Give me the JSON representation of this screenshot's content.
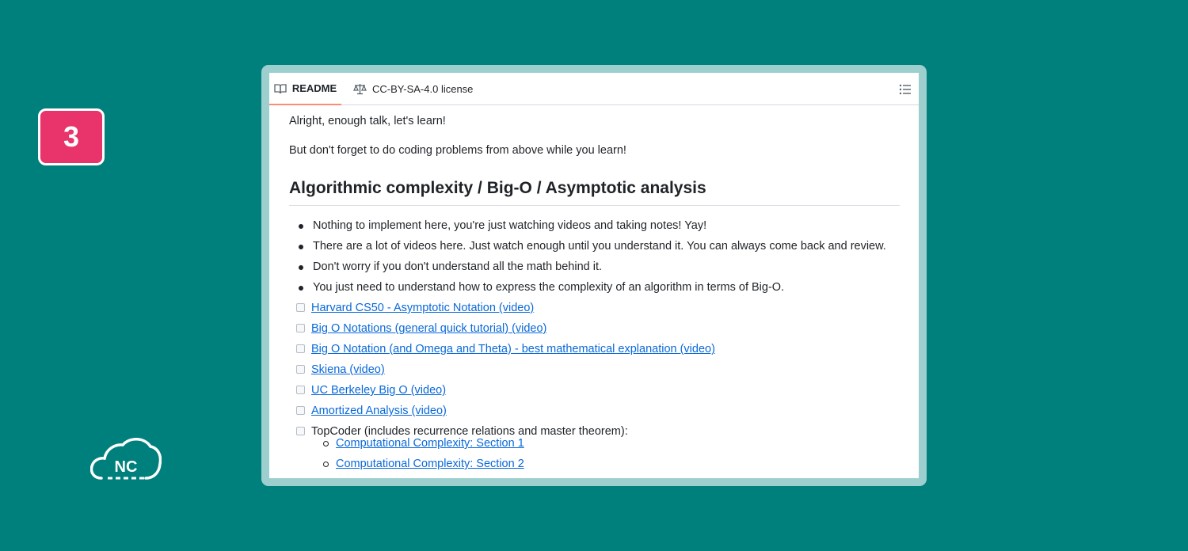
{
  "step_badge": "3",
  "tabs": {
    "readme": "README",
    "license": "CC-BY-SA-4.0 license"
  },
  "readme": {
    "intro": "Alright, enough talk, let's learn!",
    "reminder": "But don't forget to do coding problems from above while you learn!",
    "heading": "Algorithmic complexity / Big-O / Asymptotic analysis",
    "bullets": [
      "Nothing to implement here, you're just watching videos and taking notes! Yay!",
      "There are a lot of videos here. Just watch enough until you understand it. You can always come back and review.",
      "Don't worry if you don't understand all the math behind it.",
      "You just need to understand how to express the complexity of an algorithm in terms of Big-O."
    ],
    "tasks": [
      "Harvard CS50 - Asymptotic Notation (video)",
      "Big O Notations (general quick tutorial) (video)",
      "Big O Notation (and Omega and Theta) - best mathematical explanation (video)",
      "Skiena (video)",
      "UC Berkeley Big O (video)",
      "Amortized Analysis (video)",
      "TopCoder (includes recurrence relations and master theorem):"
    ],
    "subitems": [
      "Computational Complexity: Section 1",
      "Computational Complexity: Section 2"
    ]
  },
  "logo_text": "NC",
  "colors": {
    "background": "#00807c",
    "badge": "#e8336b",
    "frame": "#9ecfcf",
    "link": "#0969da",
    "active_tab_underline": "#fd8c73"
  }
}
